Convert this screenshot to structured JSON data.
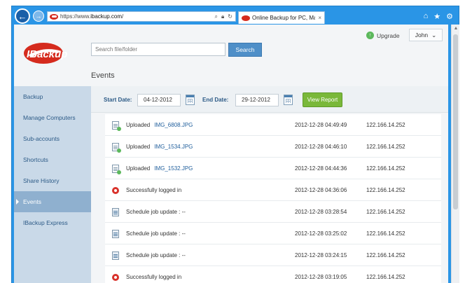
{
  "browser": {
    "url_prefix": "https://www.",
    "url_host": "ibackup.com",
    "url_suffix": "/",
    "tab_title": "Online Backup for PC, Mac ...",
    "tab_close": "×"
  },
  "header": {
    "search_placeholder": "Search file/folder",
    "search_button": "Search",
    "upgrade_label": "Upgrade",
    "user_name": "John",
    "page_title": "Events"
  },
  "logo": {
    "text": "IBackup"
  },
  "sidebar": {
    "items": [
      {
        "label": "Backup",
        "active": false
      },
      {
        "label": "Manage Computers",
        "active": false
      },
      {
        "label": "Sub-accounts",
        "active": false
      },
      {
        "label": "Shortcuts",
        "active": false
      },
      {
        "label": "Share History",
        "active": false
      },
      {
        "label": "Events",
        "active": true
      },
      {
        "label": "IBackup Express",
        "active": false
      }
    ]
  },
  "filters": {
    "start_label": "Start Date:",
    "start_value": "04-12-2012",
    "end_label": "End Date:",
    "end_value": "29-12-2012",
    "report_button": "View Report"
  },
  "events": [
    {
      "icon": "upload-file-icon",
      "action": "Uploaded",
      "file": "IMG_6808.JPG",
      "time": "2012-12-28 04:49:49",
      "ip": "122.166.14.252"
    },
    {
      "icon": "upload-file-icon",
      "action": "Uploaded",
      "file": "IMG_1534.JPG",
      "time": "2012-12-28 04:46:10",
      "ip": "122.166.14.252"
    },
    {
      "icon": "upload-file-icon",
      "action": "Uploaded",
      "file": "IMG_1532.JPG",
      "time": "2012-12-28 04:44:36",
      "ip": "122.166.14.252"
    },
    {
      "icon": "login-icon",
      "action": "Successfully logged in",
      "file": "",
      "time": "2012-12-28 04:36:06",
      "ip": "122.166.14.252"
    },
    {
      "icon": "schedule-doc-icon",
      "action": "Schedule job update : --",
      "file": "",
      "time": "2012-12-28 03:28:54",
      "ip": "122.166.14.252"
    },
    {
      "icon": "schedule-doc-icon",
      "action": "Schedule job update : --",
      "file": "",
      "time": "2012-12-28 03:25:02",
      "ip": "122.166.14.252"
    },
    {
      "icon": "schedule-doc-icon",
      "action": "Schedule job update : --",
      "file": "",
      "time": "2012-12-28 03:24:15",
      "ip": "122.166.14.252"
    },
    {
      "icon": "login-icon",
      "action": "Successfully logged in",
      "file": "",
      "time": "2012-12-28 03:19:05",
      "ip": "122.166.14.252"
    }
  ],
  "colors": {
    "browser_frame": "#2a95e6",
    "sidebar_bg": "#c9d9e8",
    "sidebar_active": "#8fb0cf",
    "search_button": "#4f8fc8",
    "report_button": "#7ab83a",
    "brand_red": "#d52b1e"
  }
}
